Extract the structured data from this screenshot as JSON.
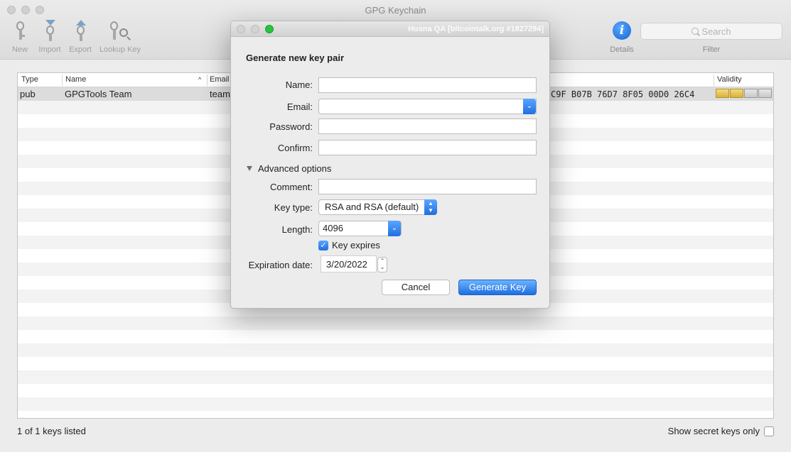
{
  "window": {
    "title": "GPG Keychain"
  },
  "toolbar": {
    "new_label": "New",
    "import_label": "Import",
    "export_label": "Export",
    "lookup_label": "Lookup Key",
    "details_label": "Details",
    "search_placeholder": "Search",
    "filter_label": "Filter"
  },
  "table": {
    "headers": {
      "type": "Type",
      "name": "Name",
      "email": "Email",
      "validity": "Validity"
    },
    "rows": [
      {
        "type": "pub",
        "name": "GPGTools Team",
        "email": "team",
        "fingerprint_tail": "C9F  B07B 76D7 8F05 00D0 26C4",
        "validity_level": 2
      }
    ]
  },
  "status": {
    "count_text": "1 of 1 keys listed",
    "secret_only_label": "Show secret keys only"
  },
  "dialog": {
    "watermark": "Husna QA [bitcointalk.org #1827294]",
    "heading": "Generate new key pair",
    "name_label": "Name:",
    "email_label": "Email:",
    "password_label": "Password:",
    "confirm_label": "Confirm:",
    "advanced_label": "Advanced options",
    "comment_label": "Comment:",
    "keytype_label": "Key type:",
    "keytype_value": "RSA and RSA (default)",
    "length_label": "Length:",
    "length_value": "4096",
    "expires_label": "Key expires",
    "expiration_label": "Expiration date:",
    "expiration_value": "3/20/2022",
    "cancel_label": "Cancel",
    "generate_label": "Generate Key"
  }
}
